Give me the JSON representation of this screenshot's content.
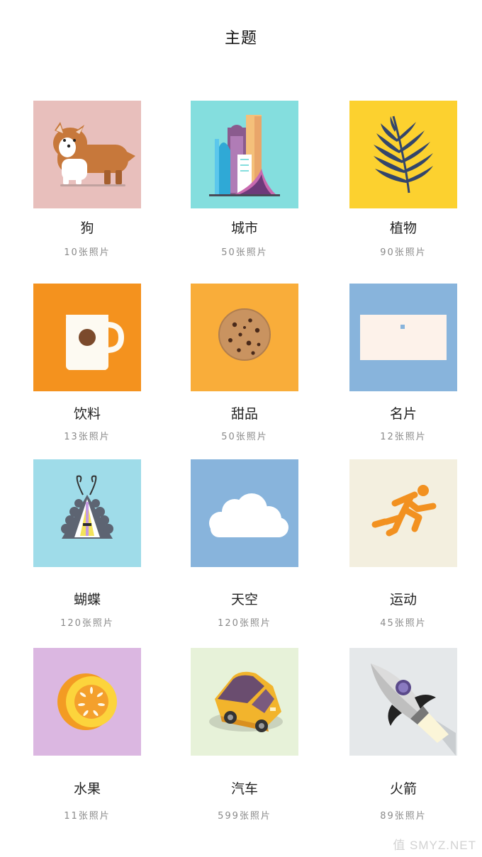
{
  "header": {
    "title": "主题"
  },
  "themes": [
    {
      "name": "狗",
      "count": "10张照片",
      "bg": "#e8bfbc",
      "icon": "dog-illustration"
    },
    {
      "name": "城市",
      "count": "50张照片",
      "bg": "#84dede",
      "icon": "city-buildings-illustration"
    },
    {
      "name": "植物",
      "count": "90张照片",
      "bg": "#fcd12f",
      "icon": "fern-leaf-illustration"
    },
    {
      "name": "饮料",
      "count": "13张照片",
      "bg": "#f4921e",
      "icon": "coffee-mug-illustration"
    },
    {
      "name": "甜品",
      "count": "50张照片",
      "bg": "#f9ad3a",
      "icon": "cookie-illustration"
    },
    {
      "name": "名片",
      "count": "12张照片",
      "bg": "#88b4dc",
      "icon": "business-card-illustration"
    },
    {
      "name": "蝴蝶",
      "count": "120张照片",
      "bg": "#9fdce9",
      "icon": "butterfly-illustration"
    },
    {
      "name": "天空",
      "count": "120张照片",
      "bg": "#88b4dc",
      "icon": "cloud-illustration"
    },
    {
      "name": "运动",
      "count": "45张照片",
      "bg": "#f3efdf",
      "icon": "runner-illustration"
    },
    {
      "name": "水果",
      "count": "11张照片",
      "bg": "#dbb7e1",
      "icon": "melon-illustration"
    },
    {
      "name": "汽车",
      "count": "599张照片",
      "bg": "#e7f2d9",
      "icon": "car-illustration"
    },
    {
      "name": "火箭",
      "count": "89张照片",
      "bg": "#e5e8ea",
      "icon": "rocket-illustration"
    }
  ],
  "watermark": "值 SMYZ.NET"
}
